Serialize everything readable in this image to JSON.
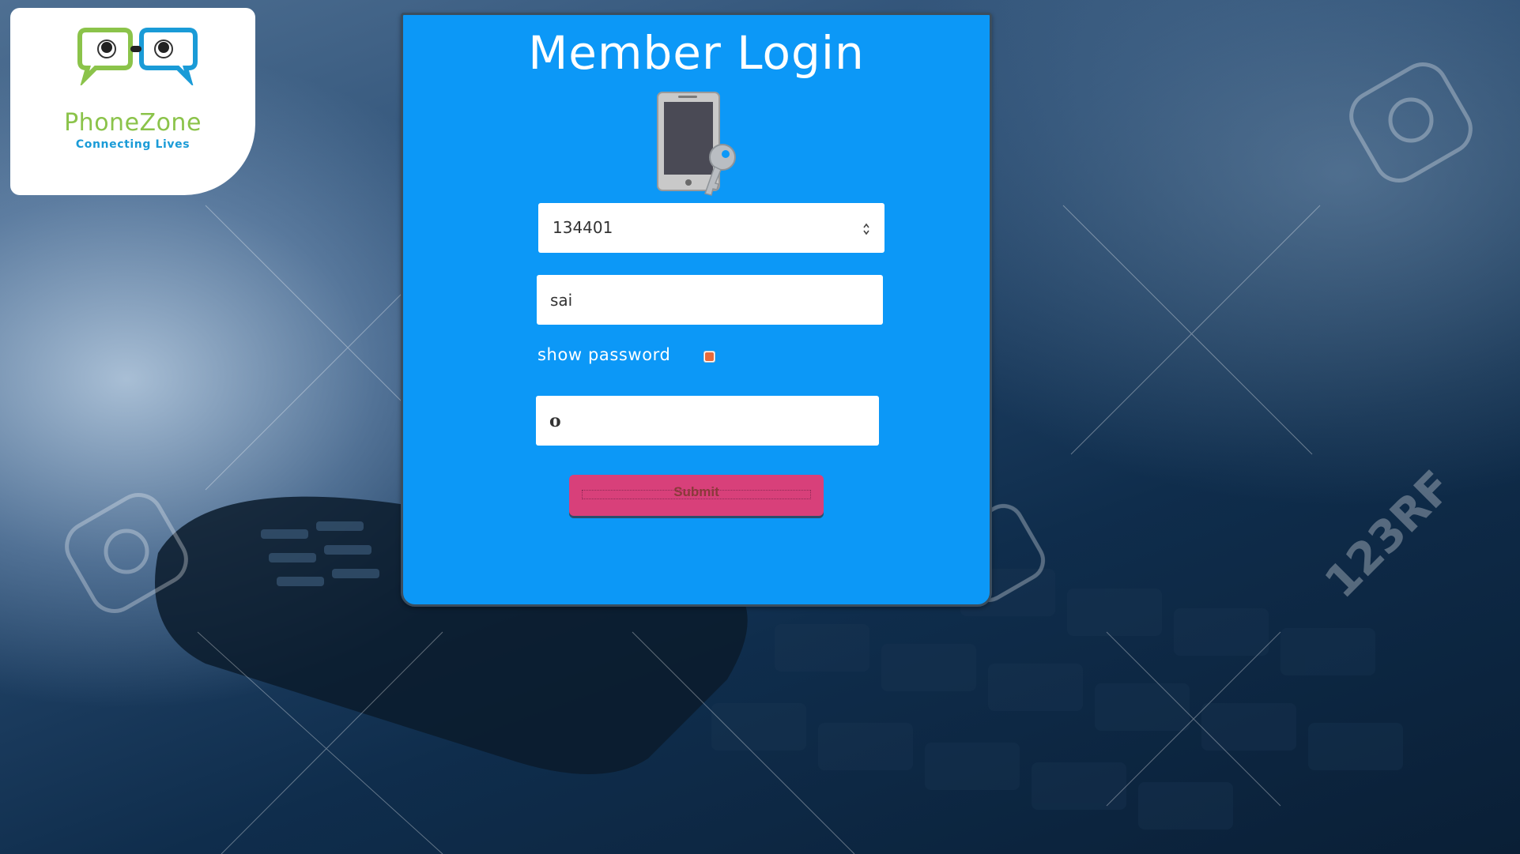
{
  "brand": {
    "name": "PhoneZone",
    "tagline": "Connecting Lives",
    "logo_icon": "chat-bubbles-eyes-icon"
  },
  "login": {
    "title": "Member Login",
    "illustration": "phone-key-icon",
    "member_id_value": "134401",
    "name_value": "sai",
    "show_password_label": "show password",
    "show_password_checked": true,
    "password_value": "o",
    "submit_label": "Submit"
  },
  "colors": {
    "panel": "#0c98f7",
    "submit": "#d8407a",
    "brand_green": "#8bc34a",
    "brand_blue": "#1a9bd7",
    "checkbox": "#e86a3a"
  }
}
